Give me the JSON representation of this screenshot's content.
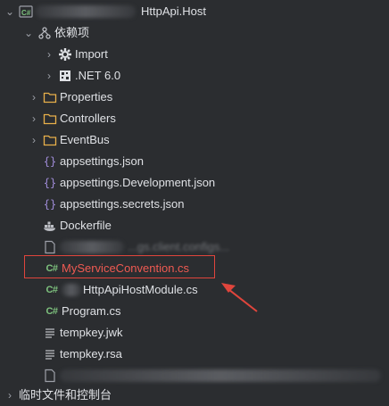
{
  "project": {
    "name_suffix": "HttpApi.Host",
    "icon": "csharp-project-icon"
  },
  "dependencies": {
    "label": "依赖项",
    "children": [
      {
        "label": "Import",
        "icon": "gear-icon"
      },
      {
        "label": ".NET 6.0",
        "icon": "dotnet-icon"
      }
    ]
  },
  "folders": [
    {
      "label": "Properties",
      "icon": "folder-icon"
    },
    {
      "label": "Controllers",
      "icon": "folder-icon"
    },
    {
      "label": "EventBus",
      "icon": "folder-icon"
    }
  ],
  "files": [
    {
      "label": "appsettings.json",
      "icon": "json-icon"
    },
    {
      "label": "appsettings.Development.json",
      "icon": "json-icon"
    },
    {
      "label": "appsettings.secrets.json",
      "icon": "json-icon"
    },
    {
      "label": "Dockerfile",
      "icon": "docker-icon"
    },
    {
      "label": "...gs.client.configs...",
      "icon": "file-icon"
    },
    {
      "label": "MyServiceConvention.cs",
      "icon": "csharp-icon"
    },
    {
      "label": "HttpApiHostModule.cs",
      "icon": "csharp-icon"
    },
    {
      "label": "Program.cs",
      "icon": "csharp-icon"
    },
    {
      "label": "tempkey.jwk",
      "icon": "text-file-icon"
    },
    {
      "label": "tempkey.rsa",
      "icon": "text-file-icon"
    }
  ],
  "bottom_item": {
    "label": "临时文件和控制台"
  },
  "icons": {
    "cs_glyph": "C#",
    "json_glyph": "{}"
  },
  "colors": {
    "background": "#2b2d30",
    "text": "#dfe1e5",
    "highlight_border": "#e0453c",
    "highlight_text": "#ef5a52",
    "csharp": "#7ec27e",
    "folder": "#e8b04a",
    "json": "#a08cd8"
  }
}
